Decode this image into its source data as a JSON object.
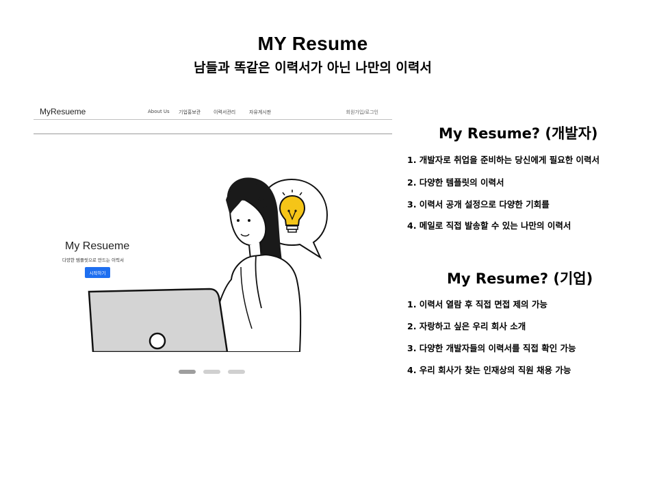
{
  "header": {
    "title": "MY Resume",
    "subtitle": "남들과 똑같은 이력서가 아닌 나만의 이력서"
  },
  "mockup": {
    "brand": "MyResueme",
    "nav": [
      "About Us",
      "기업홍보관",
      "이력서관리",
      "자유게시판"
    ],
    "auth_link": "회원가입/로그인",
    "hero_title": "My Resueme",
    "hero_subtitle": "다양한 템플릿으로 만드는 이력서",
    "hero_button": "시작하기",
    "carousel_active_index": 0,
    "carousel_count": 3
  },
  "developer": {
    "title": "My Resume? (개발자)",
    "items": [
      "1. 개발자로 취업을 준비하는 당신에게 필요한 이력서",
      "2. 다양한 템플릿의 이력서",
      "3. 이력서 공개 설정으로 다양한 기회를",
      "4. 메일로 직접 발송할 수 있는 나만의 이력서"
    ]
  },
  "company": {
    "title": "My Resume? (기업)",
    "items": [
      "1. 이력서 열람 후 직접 면접 제의 가능",
      "2. 자랑하고 싶은 우리 회사 소개",
      "3. 다양한 개발자들의 이력서를 직접 확인 가능",
      "4. 우리 회사가 찾는 인재상의 직원 채용 가능"
    ]
  },
  "colors": {
    "accent": "#1e6ff0",
    "bulb": "#f5c518",
    "dot_active": "#9e9e9e",
    "dot_inactive": "#d0d0d0"
  }
}
